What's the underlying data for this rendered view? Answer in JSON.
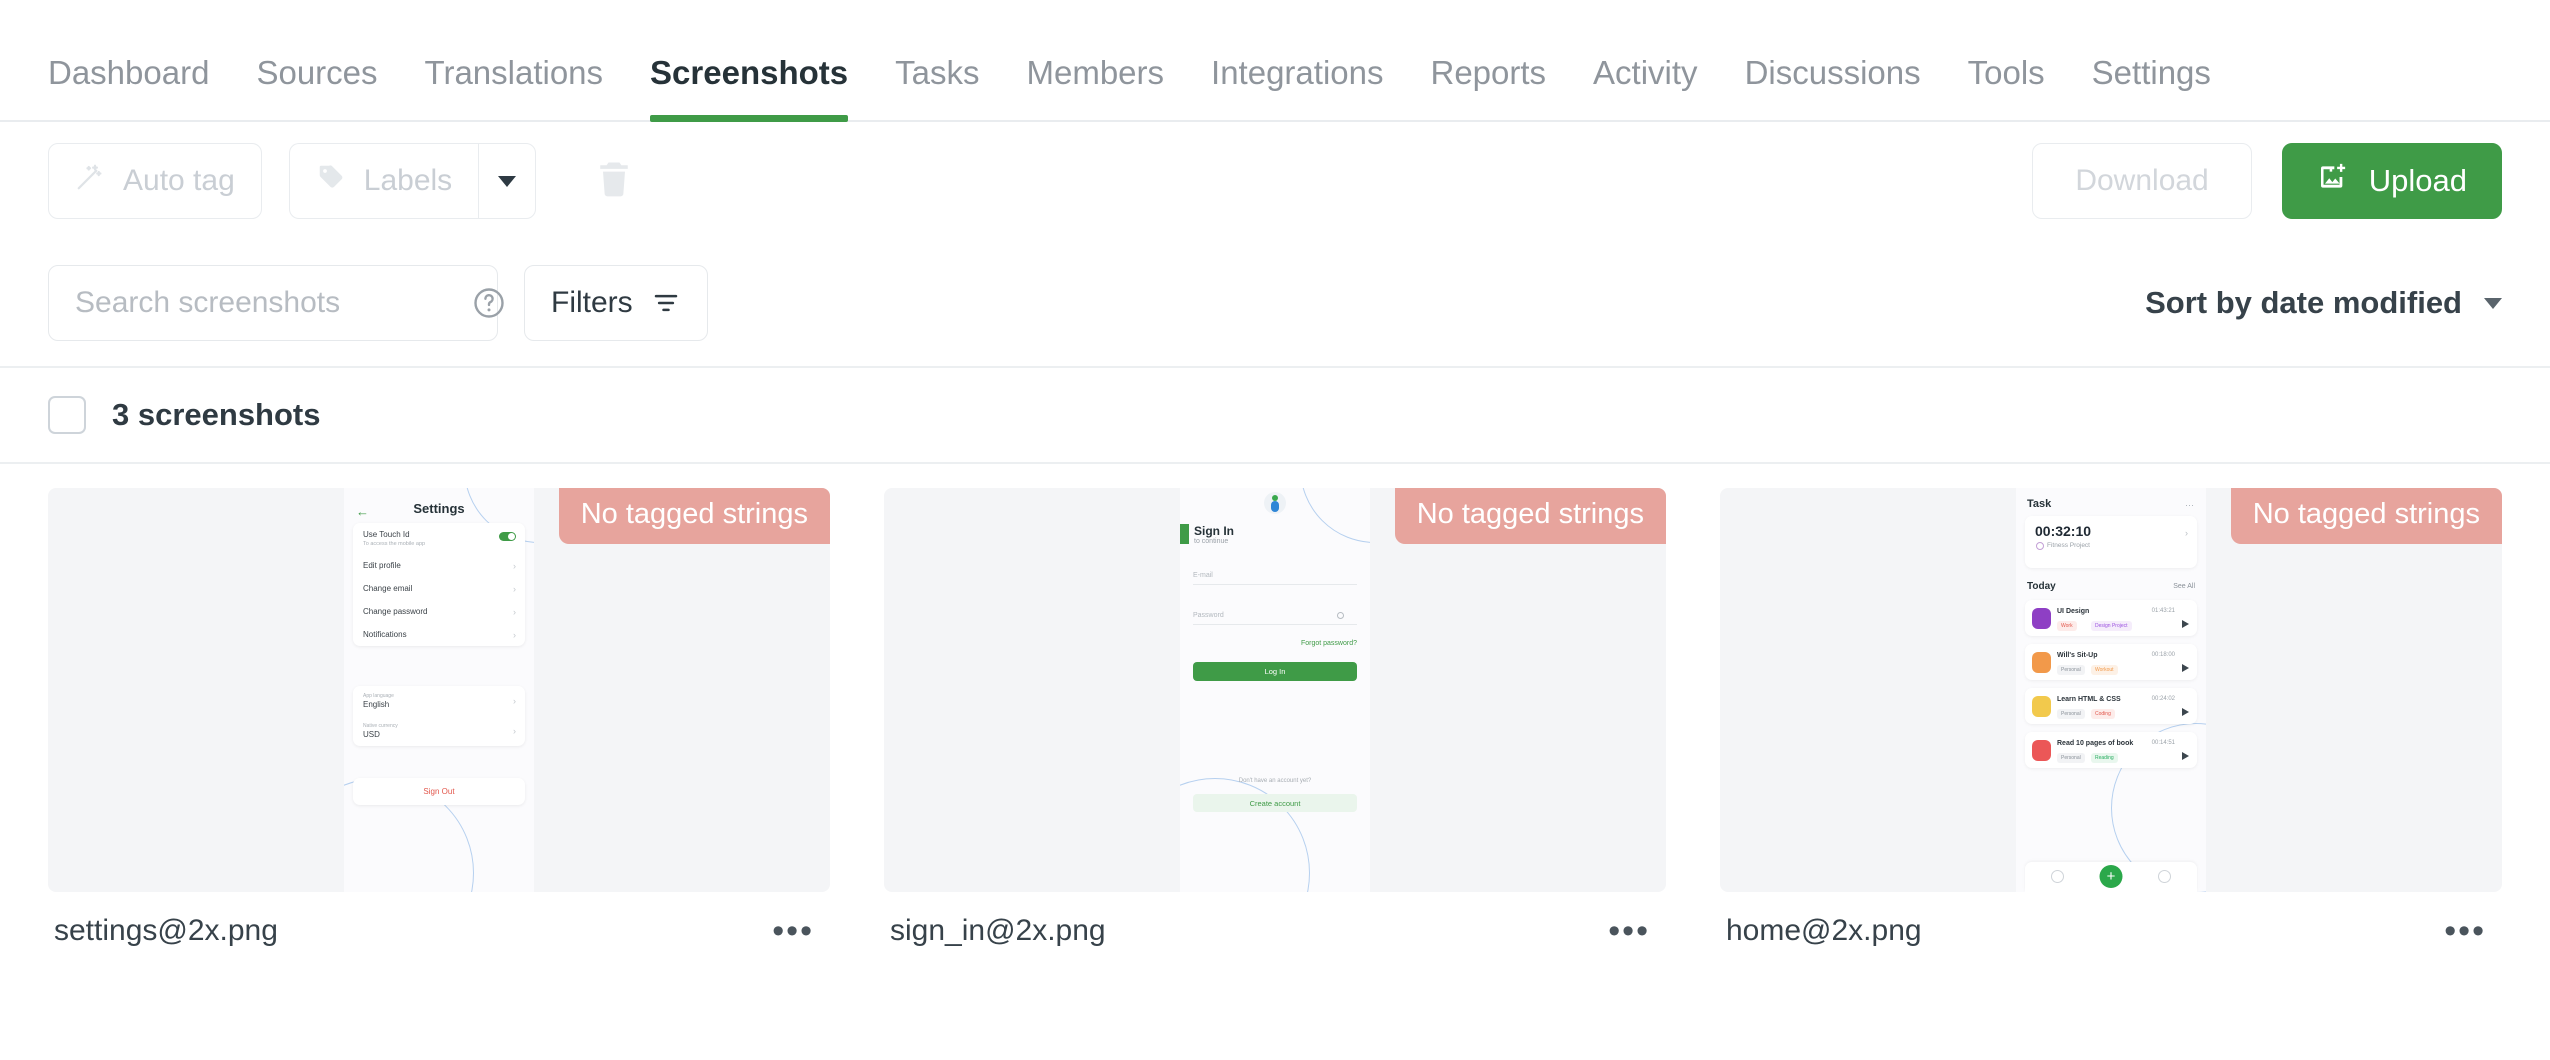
{
  "nav": {
    "items": [
      {
        "label": "Dashboard",
        "active": false
      },
      {
        "label": "Sources",
        "active": false
      },
      {
        "label": "Translations",
        "active": false
      },
      {
        "label": "Screenshots",
        "active": true
      },
      {
        "label": "Tasks",
        "active": false
      },
      {
        "label": "Members",
        "active": false
      },
      {
        "label": "Integrations",
        "active": false
      },
      {
        "label": "Reports",
        "active": false
      },
      {
        "label": "Activity",
        "active": false
      },
      {
        "label": "Discussions",
        "active": false
      },
      {
        "label": "Tools",
        "active": false
      },
      {
        "label": "Settings",
        "active": false
      }
    ]
  },
  "toolbar": {
    "auto_tag_label": "Auto tag",
    "labels_label": "Labels",
    "labels_caret_icon": "chevron-down-icon",
    "auto_tag_icon": "magic-wand-icon",
    "labels_icon": "tag-icon",
    "delete_icon": "trash-icon",
    "download_label": "Download",
    "upload_label": "Upload",
    "upload_icon": "image-add-icon",
    "accent_green": "#3f9b47"
  },
  "search": {
    "placeholder": "Search screenshots",
    "value": "",
    "help_icon": "question-circle-icon",
    "filters_label": "Filters",
    "filters_icon": "filter-icon",
    "sort_label": "Sort by date modified",
    "sort_caret_icon": "chevron-down-icon"
  },
  "list_header": {
    "select_all_checked": false,
    "count_label": "3 screenshots"
  },
  "screenshots": [
    {
      "filename": "settings@2x.png",
      "badge": "No tagged strings",
      "badge_color": "#e7a49d",
      "menu_icon": "more-horizontal-icon",
      "preview": {
        "type": "settings",
        "back_icon": "arrow-left-icon",
        "title": "Settings",
        "rows": [
          {
            "title": "Use Touch Id",
            "subtitle": "To access the mobile app",
            "toggle": true
          },
          {
            "title": "Edit profile",
            "chevron": true
          },
          {
            "title": "Change email",
            "chevron": true
          },
          {
            "title": "Change password",
            "chevron": true
          },
          {
            "title": "Notifications",
            "chevron": true
          }
        ],
        "fields": [
          {
            "label": "App language",
            "value": "English"
          },
          {
            "label": "Native currency",
            "value": "USD"
          }
        ],
        "signout": "Sign Out"
      }
    },
    {
      "filename": "sign_in@2x.png",
      "badge": "No tagged strings",
      "badge_color": "#e7a49d",
      "menu_icon": "more-horizontal-icon",
      "preview": {
        "type": "signin",
        "title": "Sign In",
        "subtitle": "to continue",
        "email_placeholder": "E-mail",
        "password_placeholder": "Password",
        "password_eye_icon": "eye-icon",
        "forgot": "Forgot password?",
        "login_button": "Log In",
        "no_account": "Don't have an account yet?",
        "create_button": "Create account"
      }
    },
    {
      "filename": "home@2x.png",
      "badge": "No tagged strings",
      "badge_color": "#e7a49d",
      "menu_icon": "more-horizontal-icon",
      "preview": {
        "type": "home",
        "title": "Task",
        "menu_icon": "more-horizontal-icon",
        "timer": "00:32:10",
        "project": "Fitness Project",
        "section": "Today",
        "see_all": "See All",
        "tasks": [
          {
            "name": "UI Design",
            "duration": "01:43:21",
            "tags": [
              {
                "text": "Work",
                "color": "#e2574c",
                "bg": "#fdecea"
              },
              {
                "text": "Design Project",
                "color": "#9b51e0",
                "bg": "#f5edfb"
              }
            ],
            "avatar": "#8e3fc4",
            "play_icon": "play-icon"
          },
          {
            "name": "Will's Sit-Up",
            "duration": "00:18:00",
            "tags": [
              {
                "text": "Personal",
                "color": "#8a9199",
                "bg": "#f2f3f5"
              },
              {
                "text": "Workout",
                "color": "#f2994a",
                "bg": "#fdf1e6"
              }
            ],
            "avatar": "#f2994a",
            "play_icon": "play-icon"
          },
          {
            "name": "Learn HTML & CSS",
            "duration": "00:24:02",
            "tags": [
              {
                "text": "Personal",
                "color": "#8a9199",
                "bg": "#f2f3f5"
              },
              {
                "text": "Coding",
                "color": "#e2574c",
                "bg": "#fdecea"
              }
            ],
            "avatar": "#f2c94c",
            "play_icon": "play-icon"
          },
          {
            "name": "Read 10 pages of book",
            "duration": "00:14:51",
            "tags": [
              {
                "text": "Personal",
                "color": "#8a9199",
                "bg": "#f2f3f5"
              },
              {
                "text": "Reading",
                "color": "#27ae60",
                "bg": "#e9f7ee"
              }
            ],
            "avatar": "#eb5757",
            "play_icon": "play-icon"
          }
        ],
        "nav_left_icon": "clock-icon",
        "nav_add_icon": "plus-icon",
        "nav_right_icon": "timer-icon"
      }
    }
  ]
}
